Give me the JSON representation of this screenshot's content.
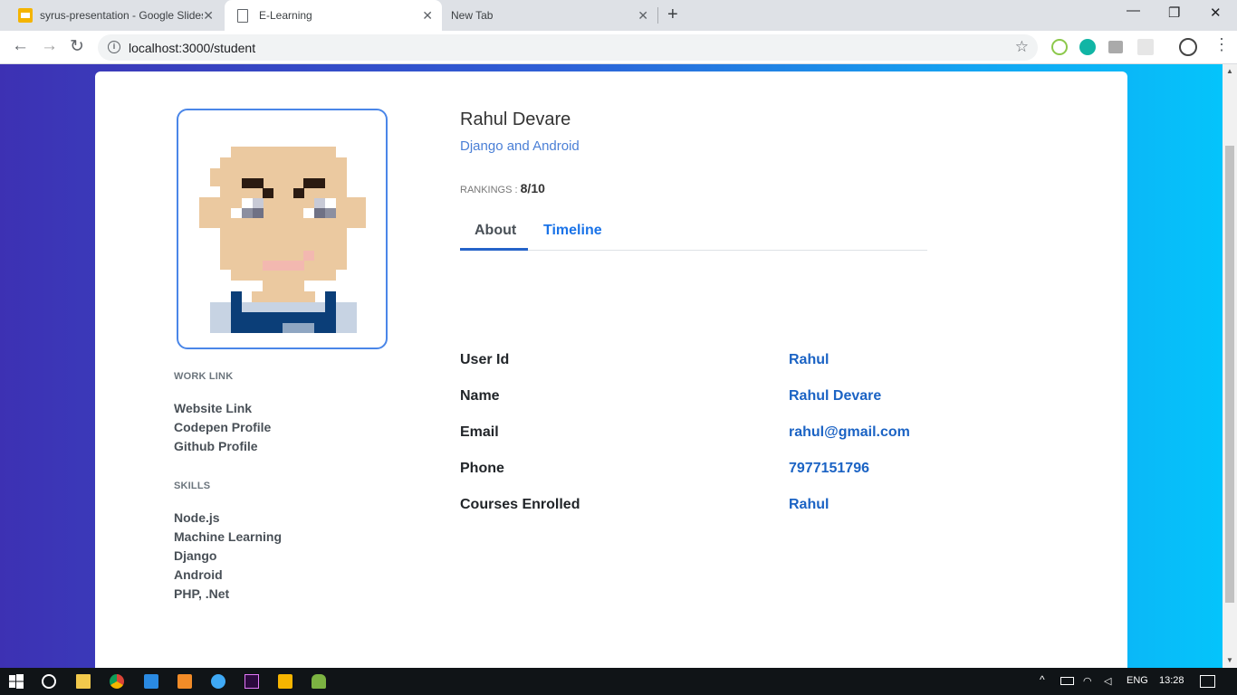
{
  "browser": {
    "tabs": [
      {
        "title": "syrus-presentation - Google Slides"
      },
      {
        "title": "E-Learning"
      },
      {
        "title": "New Tab"
      }
    ],
    "url": "localhost:3000/student"
  },
  "profile": {
    "name": "Rahul Devare",
    "subtitle": "Django and Android",
    "rankings_label": "RANKINGS :",
    "rankings_value": "8/10",
    "tabs": [
      {
        "label": "About"
      },
      {
        "label": "Timeline"
      }
    ]
  },
  "sidebar": {
    "work_heading": "WORK LINK",
    "work_links": [
      "Website Link",
      "Codepen Profile",
      "Github Profile"
    ],
    "skills_heading": "SKILLS",
    "skills": [
      "Node.js",
      "Machine Learning",
      "Django",
      "Android",
      "PHP, .Net"
    ]
  },
  "about": {
    "rows": [
      {
        "label": "User Id",
        "value": "Rahul"
      },
      {
        "label": "Name",
        "value": "Rahul Devare"
      },
      {
        "label": "Email",
        "value": "rahul@gmail.com"
      },
      {
        "label": "Phone",
        "value": "7977151796"
      },
      {
        "label": "Courses Enrolled",
        "value": "Rahul"
      }
    ]
  },
  "taskbar": {
    "language": "ENG",
    "time": "13:28"
  },
  "colors": {
    "accent": "#1b63c4",
    "avatar_border": "#4a86e8",
    "gradient_start": "#3d31b3",
    "gradient_end": "#04c4fb"
  }
}
